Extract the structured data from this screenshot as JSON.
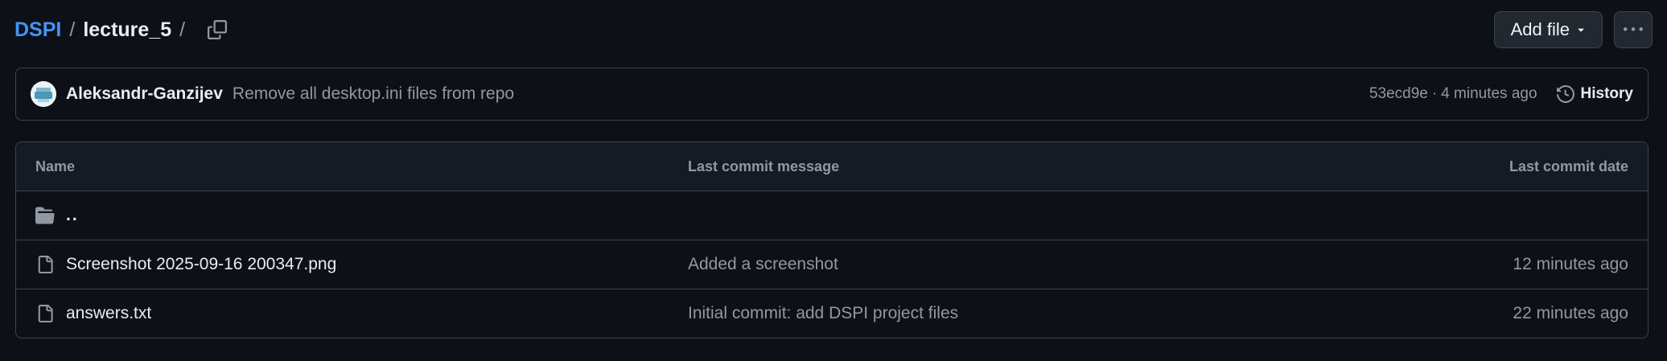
{
  "breadcrumb": {
    "repo": "DSPI",
    "separator": "/",
    "folder": "lecture_5",
    "trailing_separator": "/"
  },
  "actions": {
    "add_file_label": "Add file",
    "more_label": "···"
  },
  "latest_commit": {
    "author": "Aleksandr-Ganzijev",
    "message": "Remove all desktop.ini files from repo",
    "sha": "53ecd9e",
    "dot": "·",
    "time": "4 minutes ago",
    "history_label": "History"
  },
  "table": {
    "headers": {
      "name": "Name",
      "message": "Last commit message",
      "date": "Last commit date"
    },
    "parent": "..",
    "files": [
      {
        "name": "Screenshot 2025-09-16 200347.png",
        "message": "Added a screenshot",
        "date": "12 minutes ago",
        "icon": "file-icon"
      },
      {
        "name": "answers.txt",
        "message": "Initial commit: add DSPI project files",
        "date": "22 minutes ago",
        "icon": "file-icon"
      }
    ]
  },
  "colors": {
    "background": "#0d1117",
    "link": "#4493f8",
    "border": "#3d444d",
    "muted": "#9198a1",
    "folder": "#9198a1"
  }
}
